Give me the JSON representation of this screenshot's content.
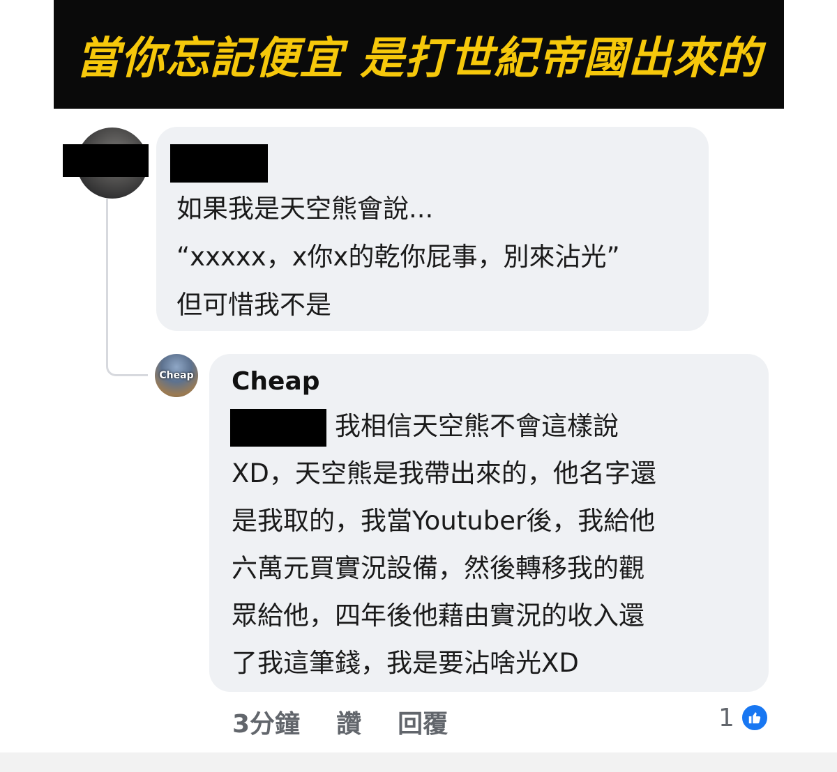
{
  "banner": {
    "title": "當你忘記便宜 是打世紀帝國出來的"
  },
  "comment1": {
    "lines": [
      "如果我是天空熊會說...",
      "“xxxxx，x你x的乾你屁事，別來沾光”",
      "但可惜我不是"
    ]
  },
  "comment2": {
    "author": "Cheap",
    "avatar_label": "Cheap",
    "lines": [
      "我相信天空熊不會這樣說",
      "XD，天空熊是我帶出來的，他名字還",
      "是我取的，我當Youtuber後，我給他",
      "六萬元買實況設備，然後轉移我的觀",
      "眾給他，四年後他藉由實況的收入還",
      "了我這筆錢，我是要沾啥光XD"
    ]
  },
  "actions": {
    "time": "3分鐘",
    "like_label": "讚",
    "reply_label": "回覆",
    "reaction_count": "1",
    "reaction_icon": "thumbs-up-icon"
  },
  "colors": {
    "banner_bg": "#0a0a0a",
    "banner_text": "#f6c80b",
    "bubble_bg": "#eff1f4",
    "like_blue": "#1877f2"
  }
}
